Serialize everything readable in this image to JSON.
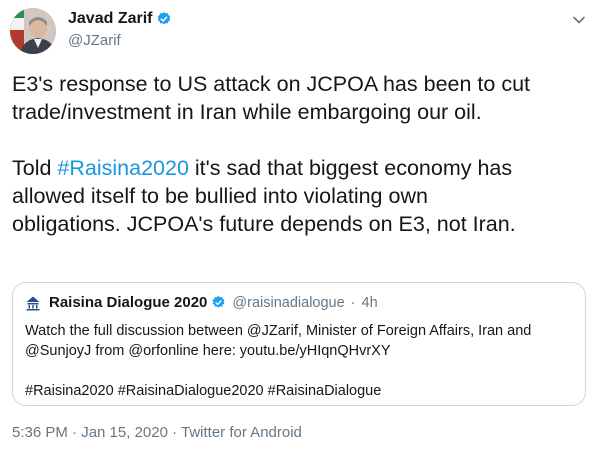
{
  "author": {
    "display_name": "Javad Zarif",
    "handle": "@JZarif",
    "verified": true,
    "avatar_icon": "profile-photo"
  },
  "tweet": {
    "paragraph1": [
      "E3's response to US attack on JCPOA has been to cut",
      "trade/investment in Iran while embargoing our oil."
    ],
    "paragraph2": {
      "line1_prefix": "Told ",
      "hashtag": "#Raisina2020",
      "line1_suffix": " it's sad that biggest economy has",
      "line2": "allowed itself to be bullied into violating own",
      "line3": "obligations. JCPOA's future depends on E3, not Iran."
    }
  },
  "quoted_tweet": {
    "display_name": "Raisina Dialogue 2020",
    "handle": "@raisinadialogue",
    "separator": "·",
    "time_ago": "4h",
    "verified": true,
    "logo_icon": "raisina-logo",
    "lines": [
      "Watch the full discussion between @JZarif, Minister of Foreign Affairs, Iran and",
      "@SunjoyJ from @orfonline here: youtu.be/yHIqnQHvrXY"
    ],
    "hashtags": "#Raisina2020 #RaisinaDialogue2020 #RaisinaDialogue"
  },
  "meta": {
    "timestamp": "5:36 PM · Jan 15, 2020",
    "separator": " · ",
    "source": "Twitter for Android"
  },
  "colors": {
    "link": "#1b95e0",
    "secondary_text": "#657786",
    "border": "#ccd6dd",
    "verified_badge": "#1da1f2"
  },
  "icons": {
    "menu": "chevron-down-icon",
    "verified": "verified-badge-icon"
  }
}
